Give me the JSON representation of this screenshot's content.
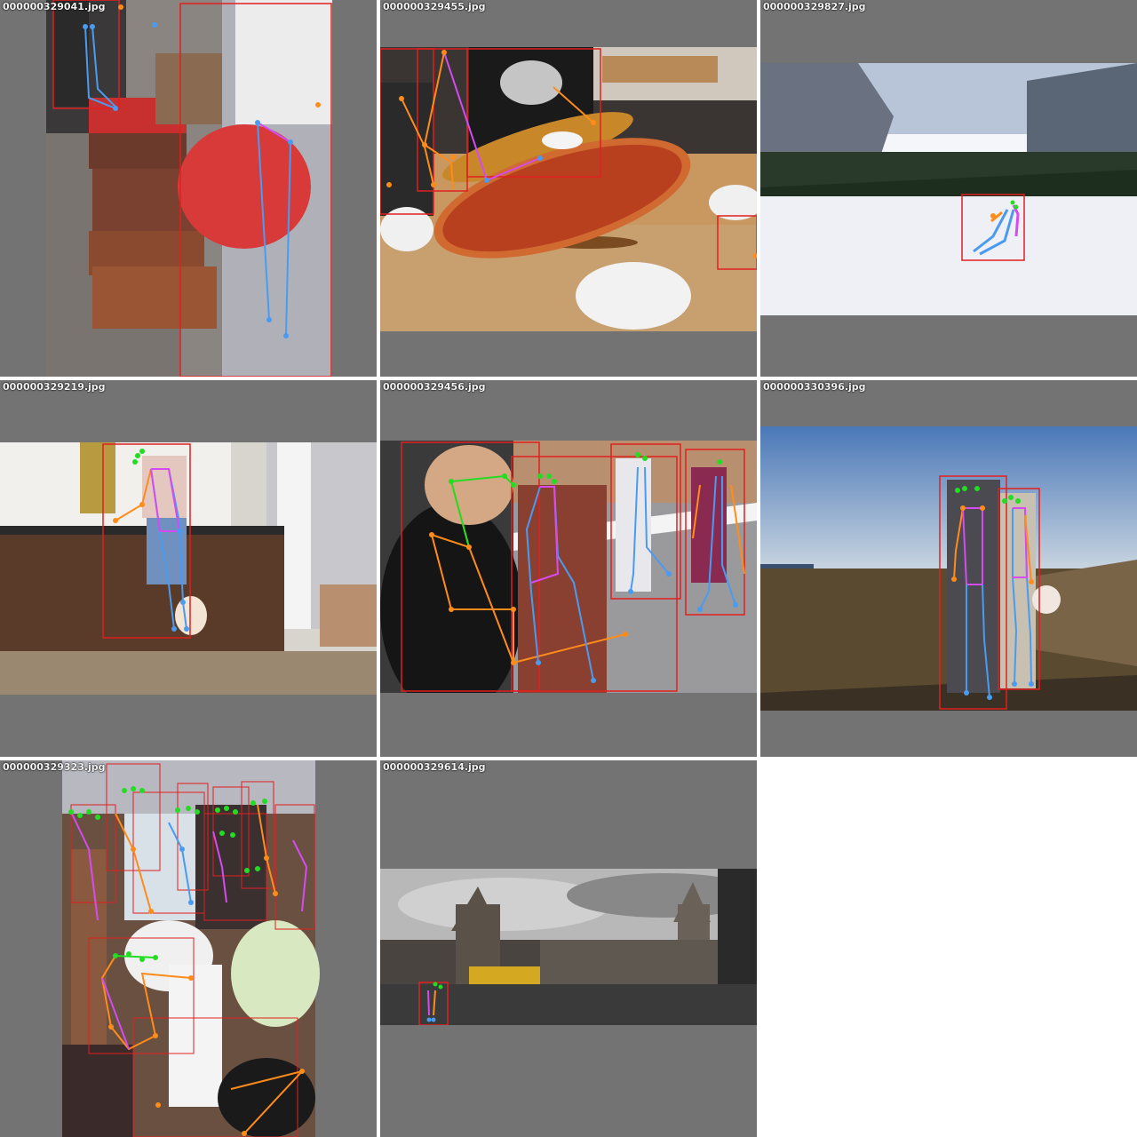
{
  "tiles": [
    {
      "filename": "000000329041.jpg"
    },
    {
      "filename": "000000329455.jpg"
    },
    {
      "filename": "000000329827.jpg"
    },
    {
      "filename": "000000329219.jpg"
    },
    {
      "filename": "000000329456.jpg"
    },
    {
      "filename": "000000330396.jpg"
    },
    {
      "filename": "000000329323.jpg"
    },
    {
      "filename": "000000329614.jpg"
    }
  ],
  "colors": {
    "tile_background": "#737373",
    "bbox": "#e02020",
    "keypoint_face": "#22dd22",
    "keypoint_left": "#ff8c1a",
    "keypoint_right": "#4a9bf0",
    "keypoint_torso": "#d44bf0"
  }
}
